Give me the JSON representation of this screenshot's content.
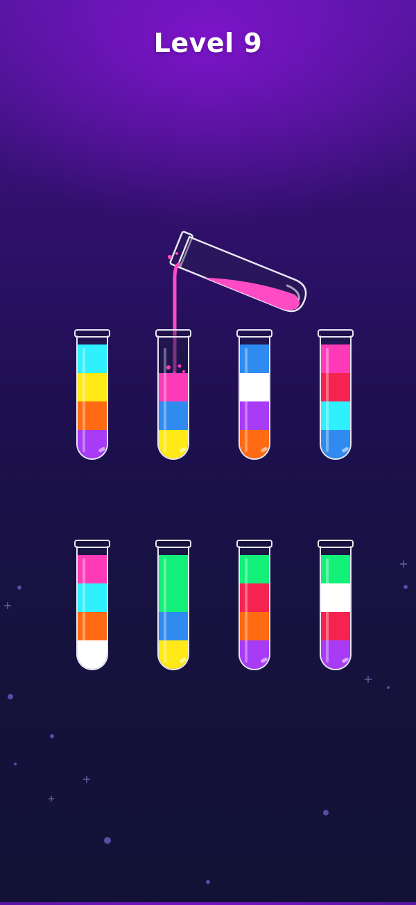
{
  "level": {
    "title": "Level 9"
  },
  "colors": {
    "cyan": "#2ff0ff",
    "yellow": "#ffe916",
    "orange": "#ff6a12",
    "purple": "#a83bf5",
    "blue": "#2f8bef",
    "pink": "#ff3ab8",
    "white": "#ffffff",
    "red": "#f5234f",
    "green": "#12f07a",
    "pour_liquid": "#ff4cc4"
  },
  "tubes": [
    {
      "id": "tube-1",
      "segments": [
        "purple",
        "orange",
        "yellow",
        "cyan"
      ]
    },
    {
      "id": "tube-2",
      "segments": [
        "yellow",
        "blue",
        "pink"
      ]
    },
    {
      "id": "tube-3",
      "segments": [
        "orange",
        "purple",
        "white",
        "blue"
      ]
    },
    {
      "id": "tube-4",
      "segments": [
        "blue",
        "cyan",
        "red",
        "pink"
      ]
    },
    {
      "id": "tube-5",
      "segments": [
        "white",
        "orange",
        "cyan",
        "pink"
      ]
    },
    {
      "id": "tube-6",
      "segments": [
        "yellow",
        "blue",
        "green",
        "green"
      ]
    },
    {
      "id": "tube-7",
      "segments": [
        "purple",
        "orange",
        "red",
        "green"
      ]
    },
    {
      "id": "tube-8",
      "segments": [
        "purple",
        "red",
        "white",
        "green"
      ]
    }
  ],
  "pouring_tube": {
    "liquid_color": "pink",
    "target_tube": "tube-2"
  }
}
